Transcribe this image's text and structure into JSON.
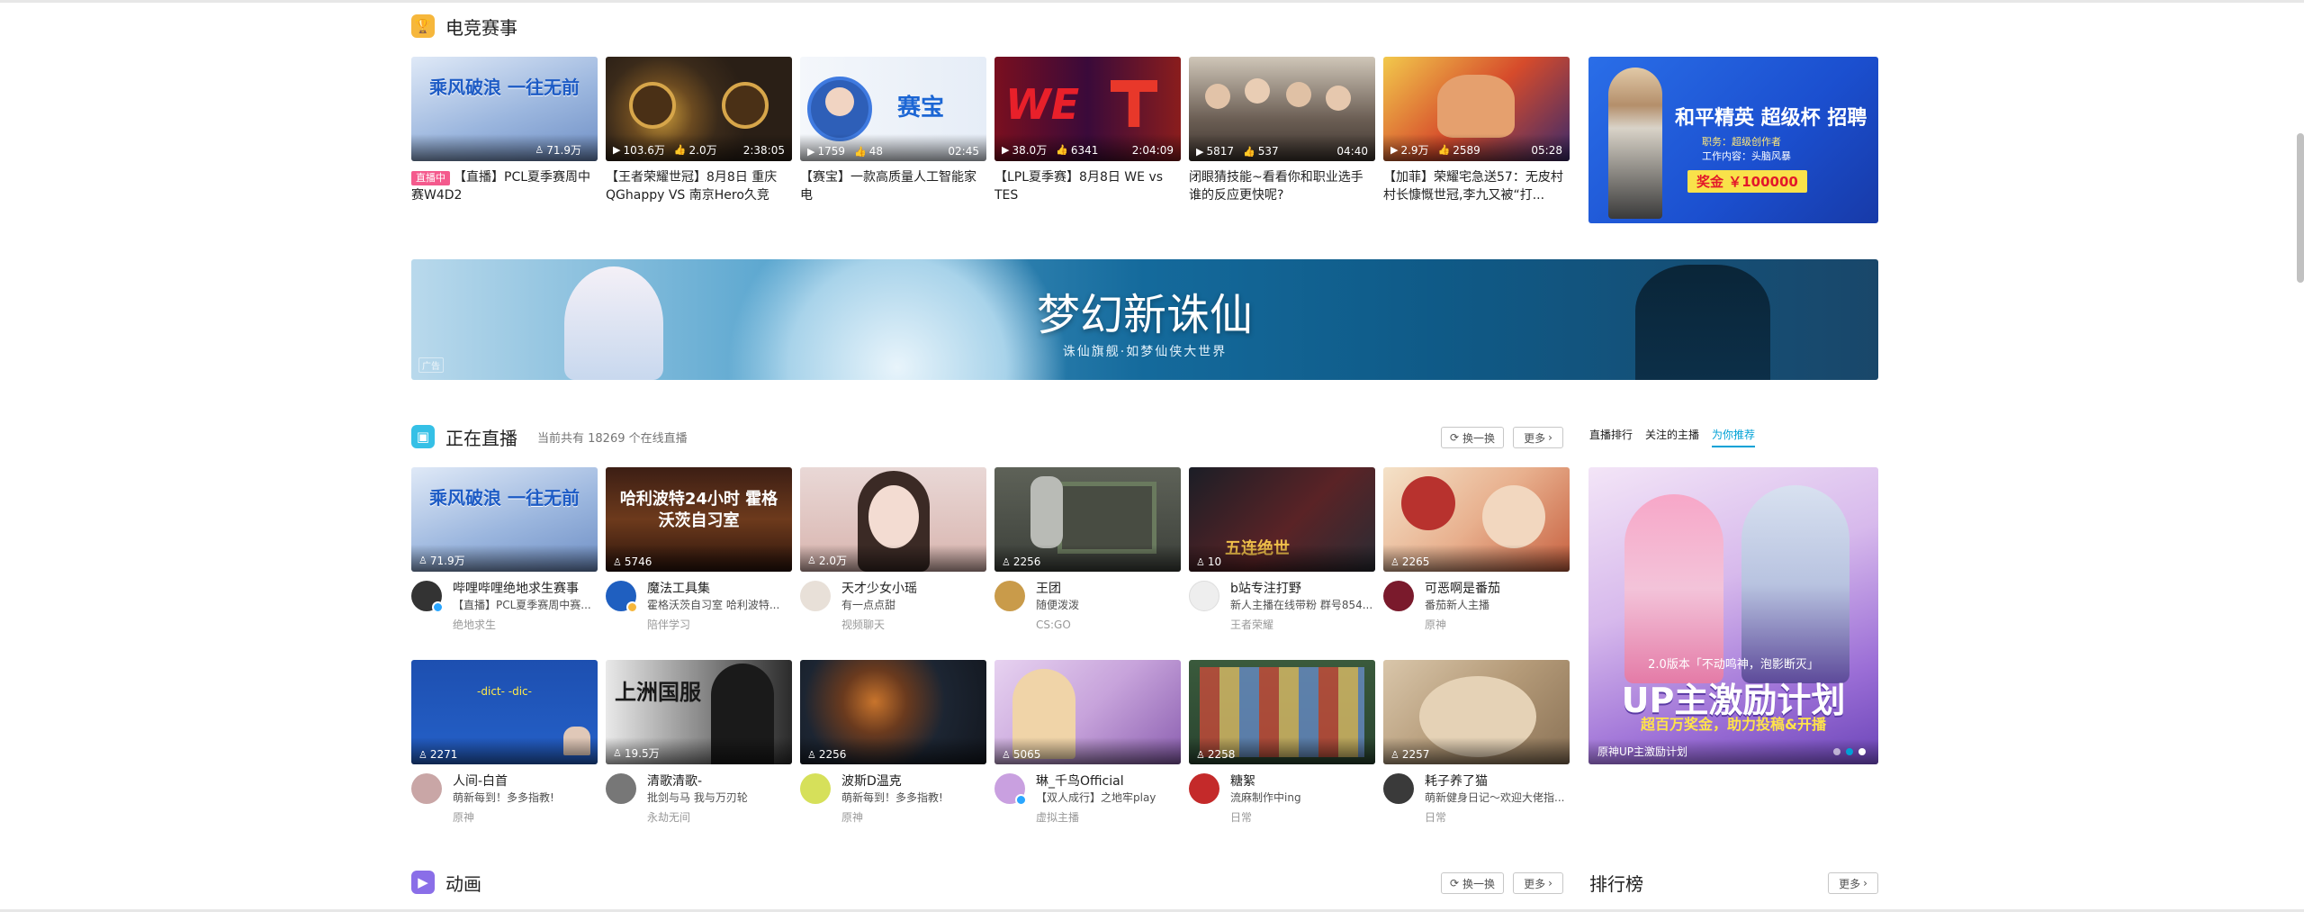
{
  "esports": {
    "title": "电竞赛事",
    "cards": [
      {
        "tag": "直播中",
        "title": "【直播】PCL夏季赛周中赛W4D2",
        "stats": [
          "71.9万"
        ],
        "duration": "",
        "thumb_text": "乘风破浪 一往无前"
      },
      {
        "title": "【王者荣耀世冠】8月8日 重庆QGhappy VS 南京Hero久竞",
        "stats": [
          "103.6万",
          "2.0万"
        ],
        "duration": "2:38:05"
      },
      {
        "title": "【赛宝】一款高质量人工智能家电",
        "stats": [
          "1759",
          "48"
        ],
        "duration": "02:45",
        "thumb_text": "赛宝"
      },
      {
        "title": "【LPL夏季赛】8月8日 WE vs TES",
        "stats": [
          "38.0万",
          "6341"
        ],
        "duration": "2:04:09"
      },
      {
        "title": "闭眼猜技能~看看你和职业选手谁的反应更快呢?",
        "stats": [
          "5817",
          "537"
        ],
        "duration": "04:40"
      },
      {
        "title": "【加菲】荣耀宅急送57：无皮村村长慷慨世冠,李九又被“打...",
        "stats": [
          "2.9万",
          "2589"
        ],
        "duration": "05:28"
      }
    ],
    "banner": {
      "title": "和平精英 超级杯 招聘",
      "sub1": "职务：超级创作者",
      "sub2": "工作内容：头脑风暴",
      "prize": "奖金 ￥100000"
    }
  },
  "ad": {
    "logo": "梦幻新诛仙",
    "slogan": "诛仙旗舰·如梦仙侠大世界",
    "label": "广告"
  },
  "live": {
    "title": "正在直播",
    "subtitle": "当前共有 18269 个在线直播",
    "refresh": "换一换",
    "more": "更多",
    "tabs": [
      "直播排行",
      "关注的主播",
      "为你推荐"
    ],
    "cards": [
      {
        "name": "哔哩哔哩绝地求生赛事",
        "desc": "【直播】PCL夏季赛周中赛...",
        "category": "绝地求生",
        "viewers": "71.9万",
        "thumb_text": "乘风破浪 一往无前"
      },
      {
        "name": "魔法工具集",
        "desc": "霍格沃茨自习室 哈利波特...",
        "category": "陪伴学习",
        "viewers": "5746",
        "thumb_text": "哈利波特24小时 霍格沃茨自习室"
      },
      {
        "name": "天才少女小瑶",
        "desc": "有一点点甜",
        "category": "视频聊天",
        "viewers": "2.0万"
      },
      {
        "name": "王团",
        "desc": "随便泼泼",
        "category": "CS:GO",
        "viewers": "2256"
      },
      {
        "name": "b站专注打野",
        "desc": "新人主播在线带粉 群号854...",
        "category": "王者荣耀",
        "viewers": "10",
        "thumb_text": "五连绝世"
      },
      {
        "name": "可恶啊是番茄",
        "desc": "番茄新人主播",
        "category": "原神",
        "viewers": "2265"
      },
      {
        "name": "人间-白首",
        "desc": "萌新每到！多多指教!",
        "category": "原神",
        "viewers": "2271",
        "thumb_text": "-dict- -dic-"
      },
      {
        "name": "清歌清歌-",
        "desc": "批剑与马 我与万刃轮",
        "category": "永劫无间",
        "viewers": "19.5万",
        "thumb_text": "上洲国服"
      },
      {
        "name": "波斯D温克",
        "desc": "萌新每到！多多指教!",
        "category": "原神",
        "viewers": "2256"
      },
      {
        "name": "琳_千鸟Official",
        "desc": "【双人成行】之地牢play",
        "category": "虚拟主播",
        "viewers": "5065"
      },
      {
        "name": "糖絮",
        "desc": "流麻制作中ing",
        "category": "日常",
        "viewers": "2258"
      },
      {
        "name": "耗子养了猫",
        "desc": "萌新健身日记～欢迎大佬指...",
        "category": "日常",
        "viewers": "2257"
      }
    ],
    "banner": {
      "headline": "2.0版本「不动鸣神，泡影断灭」",
      "big": "UP主激励计划",
      "sub": "超百万奖金，助力投稿&开播",
      "caption": "原神UP主激励计划"
    }
  },
  "anime": {
    "title": "动画",
    "refresh": "换一换",
    "more": "更多"
  },
  "ranking": {
    "title": "排行榜",
    "more": "更多"
  },
  "colors": {
    "accent": "#00a1d6",
    "live_pink": "#f45a8d",
    "text": "#212121"
  }
}
